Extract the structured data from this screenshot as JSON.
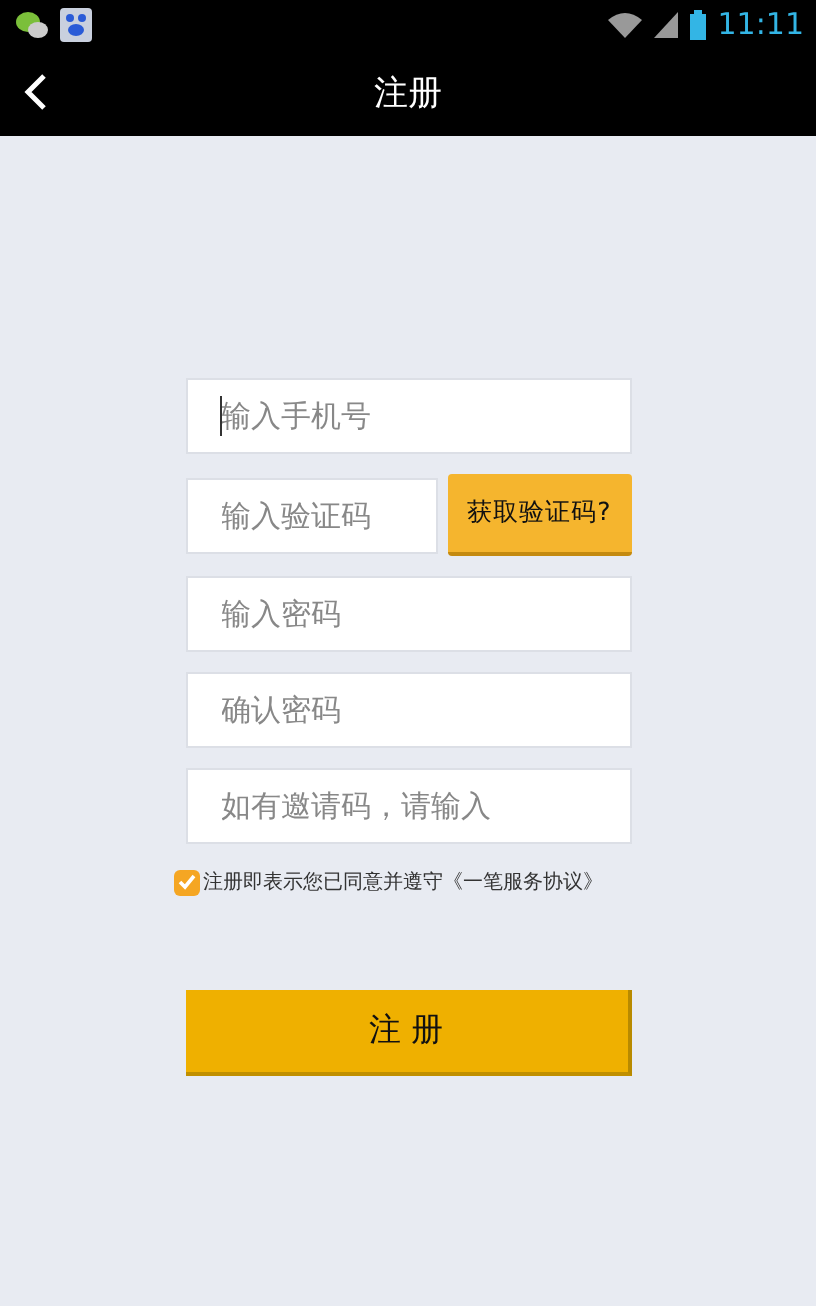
{
  "status_bar": {
    "time": "11:11"
  },
  "title_bar": {
    "title": "注册"
  },
  "fields": [
    {
      "placeholder": "输入手机号",
      "focused": true
    },
    {
      "placeholder": "输入验证码",
      "focused": false
    },
    {
      "placeholder": "输入密码",
      "focused": false
    },
    {
      "placeholder": "确认密码",
      "focused": false
    },
    {
      "placeholder": "如有邀请码，请输入",
      "focused": false
    }
  ],
  "code_button": "获取验证码?",
  "agreement": {
    "checked": true,
    "text": "注册即表示您已同意并遵守《一笔服务协议》"
  },
  "submit_button": "注 册"
}
